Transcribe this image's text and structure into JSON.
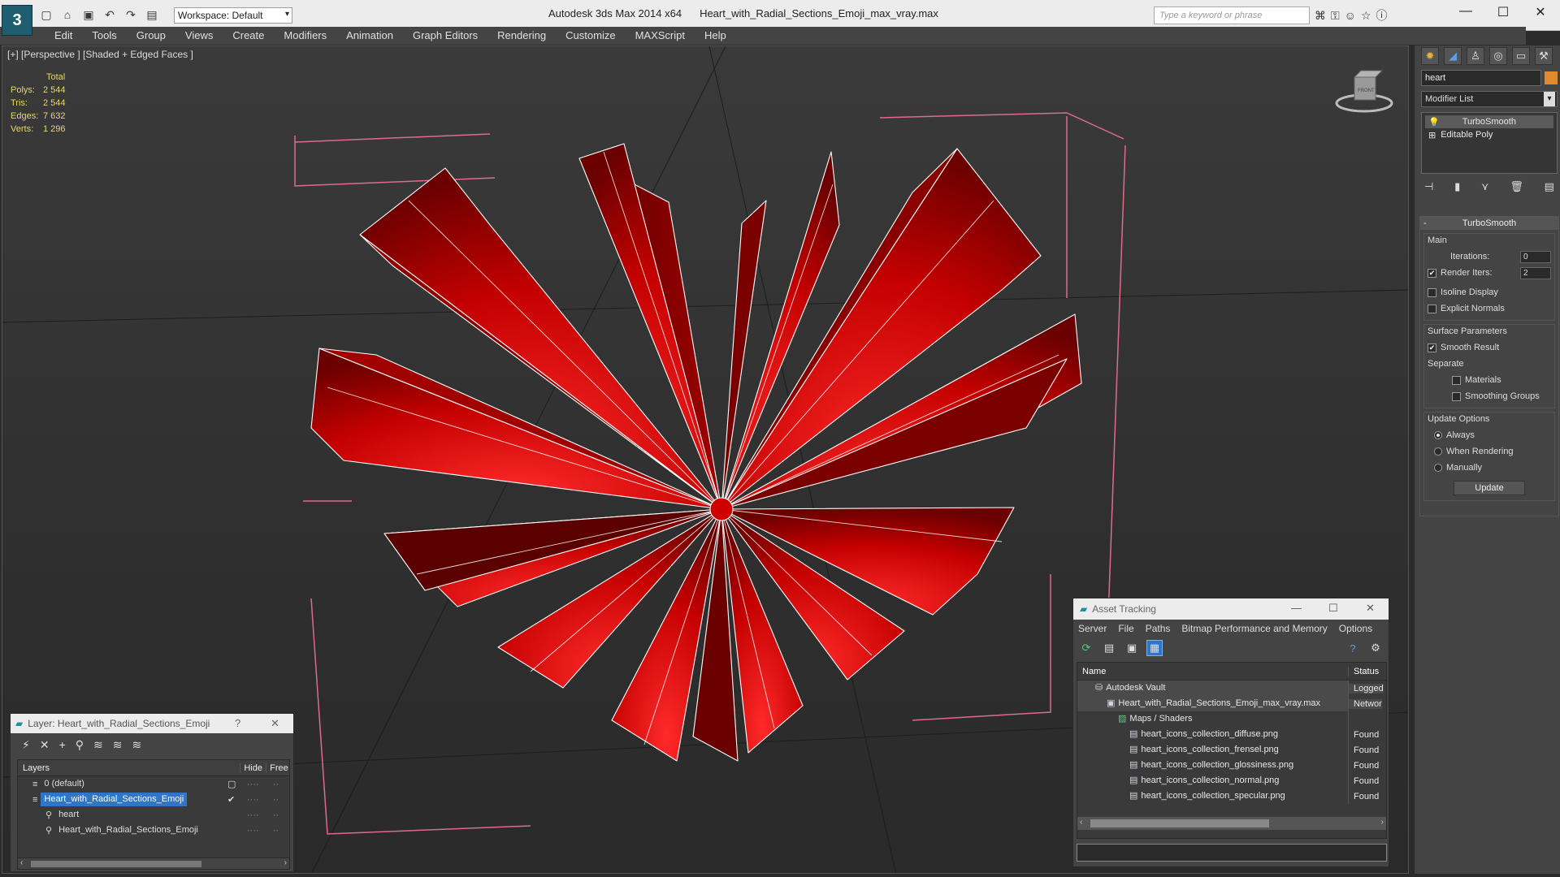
{
  "titlebar": {
    "app_title": "Autodesk 3ds Max  2014 x64",
    "file_title": "Heart_with_Radial_Sections_Emoji_max_vray.max",
    "workspace_label": "Workspace: Default",
    "search_placeholder": "Type a keyword or phrase"
  },
  "menubar": {
    "items": [
      "Edit",
      "Tools",
      "Group",
      "Views",
      "Create",
      "Modifiers",
      "Animation",
      "Graph Editors",
      "Rendering",
      "Customize",
      "MAXScript",
      "Help"
    ]
  },
  "viewport": {
    "label": "[+] [Perspective ] [Shaded + Edged Faces ]",
    "stats_header": "Total",
    "stats": [
      {
        "key": "Polys:",
        "value": "2 544"
      },
      {
        "key": "Tris:",
        "value": "2 544"
      },
      {
        "key": "Edges:",
        "value": "7 632"
      },
      {
        "key": "Verts:",
        "value": "1 296"
      }
    ],
    "viewcube_label": "FRONT",
    "object_color": "#c00000"
  },
  "command_panel": {
    "object_name": "heart",
    "modifier_list_label": "Modifier List",
    "stack": [
      "TurboSmooth",
      "Editable Poly"
    ],
    "rollout_title": "TurboSmooth",
    "main_label": "Main",
    "iterations_label": "Iterations:",
    "iterations_value": "0",
    "render_iters_label": "Render Iters:",
    "render_iters_value": "2",
    "isoline_label": "Isoline Display",
    "explicit_normals_label": "Explicit Normals",
    "surface_params_label": "Surface Parameters",
    "smooth_result_label": "Smooth Result",
    "separate_label": "Separate",
    "materials_label": "Materials",
    "smoothing_groups_label": "Smoothing Groups",
    "update_options_label": "Update Options",
    "always_label": "Always",
    "when_rendering_label": "When Rendering",
    "manually_label": "Manually",
    "update_button_label": "Update"
  },
  "layer_window": {
    "title": "Layer: Heart_with_Radial_Sections_Emoji",
    "help_glyph": "?",
    "columns": [
      "Layers",
      "Hide",
      "Free"
    ],
    "rows": [
      {
        "name": "0 (default)",
        "indent": 0,
        "selected": false
      },
      {
        "name": "Heart_with_Radial_Sections_Emoji",
        "indent": 0,
        "selected": true
      },
      {
        "name": "heart",
        "indent": 1,
        "selected": false
      },
      {
        "name": "Heart_with_Radial_Sections_Emoji",
        "indent": 1,
        "selected": false
      }
    ]
  },
  "asset_tracking": {
    "title": "Asset Tracking",
    "menu": [
      "Server",
      "File",
      "Paths",
      "Bitmap Performance and Memory",
      "Options"
    ],
    "columns": [
      "Name",
      "Status"
    ],
    "rows": [
      {
        "name": "Autodesk Vault",
        "status": "Logged",
        "indent": 1
      },
      {
        "name": "Heart_with_Radial_Sections_Emoji_max_vray.max",
        "status": "Networ",
        "indent": 2
      },
      {
        "name": "Maps / Shaders",
        "status": "",
        "indent": 3
      },
      {
        "name": "heart_icons_collection_diffuse.png",
        "status": "Found",
        "indent": 4
      },
      {
        "name": "heart_icons_collection_frensel.png",
        "status": "Found",
        "indent": 4
      },
      {
        "name": "heart_icons_collection_glossiness.png",
        "status": "Found",
        "indent": 4
      },
      {
        "name": "heart_icons_collection_normal.png",
        "status": "Found",
        "indent": 4
      },
      {
        "name": "heart_icons_collection_specular.png",
        "status": "Found",
        "indent": 4
      }
    ]
  }
}
